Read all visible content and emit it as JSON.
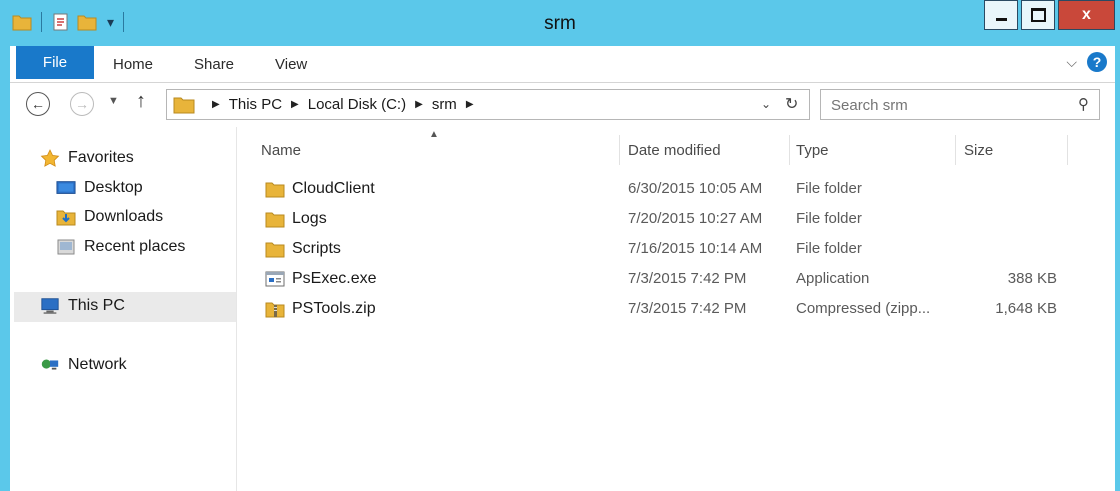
{
  "window": {
    "title": "srm"
  },
  "ribbon": {
    "tabs": [
      "File",
      "Home",
      "Share",
      "View"
    ]
  },
  "address": {
    "crumbs": [
      "This PC",
      "Local Disk (C:)",
      "srm"
    ]
  },
  "search": {
    "placeholder": "Search srm"
  },
  "nav": {
    "favorites": "Favorites",
    "items": [
      "Desktop",
      "Downloads",
      "Recent places"
    ],
    "this_pc": "This PC",
    "network": "Network"
  },
  "columns": {
    "name": "Name",
    "date": "Date modified",
    "type": "Type",
    "size": "Size"
  },
  "files": [
    {
      "name": "CloudClient",
      "date": "6/30/2015 10:05 AM",
      "type": "File folder",
      "size": "",
      "icon": "folder-icon"
    },
    {
      "name": "Logs",
      "date": "7/20/2015 10:27 AM",
      "type": "File folder",
      "size": "",
      "icon": "folder-icon"
    },
    {
      "name": "Scripts",
      "date": "7/16/2015 10:14 AM",
      "type": "File folder",
      "size": "",
      "icon": "folder-icon"
    },
    {
      "name": "PsExec.exe",
      "date": "7/3/2015 7:42 PM",
      "type": "Application",
      "size": "388 KB",
      "icon": "application-icon"
    },
    {
      "name": "PSTools.zip",
      "date": "7/3/2015 7:42 PM",
      "type": "Compressed (zipp...",
      "size": "1,648 KB",
      "icon": "zip-folder-icon"
    }
  ],
  "colors": {
    "frame": "#5bc8ea",
    "file_tab": "#1979ca",
    "close": "#c9483a",
    "folder": "#e8b43a"
  }
}
